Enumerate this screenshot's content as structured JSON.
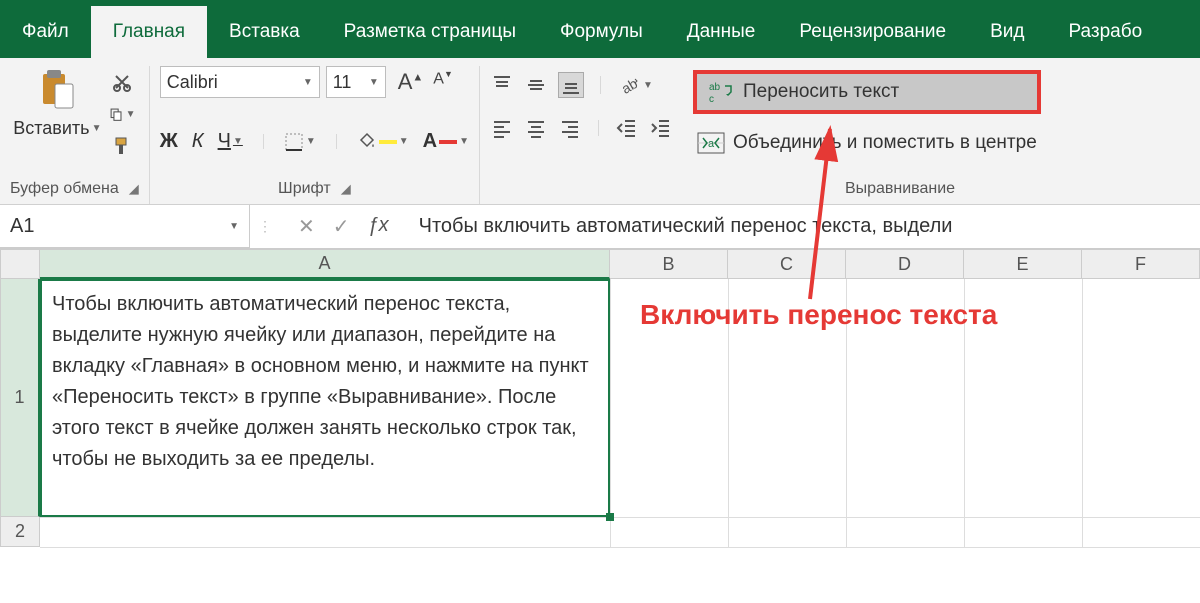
{
  "tabs": {
    "file": "Файл",
    "home": "Главная",
    "insert": "Вставка",
    "pagelayout": "Разметка страницы",
    "formulas": "Формулы",
    "data": "Данные",
    "review": "Рецензирование",
    "view": "Вид",
    "developer": "Разрабо"
  },
  "ribbon": {
    "clipboard": {
      "label": "Буфер обмена",
      "paste": "Вставить"
    },
    "font": {
      "label": "Шрифт",
      "name": "Calibri",
      "size": "11",
      "bold": "Ж",
      "italic": "К",
      "underline": "Ч"
    },
    "alignment": {
      "label": "Выравнивание",
      "wrap": "Переносить текст",
      "merge": "Объединить и поместить в центре"
    }
  },
  "namebox": "A1",
  "formula_bar": "Чтобы включить автоматический перенос текста, выдели",
  "columns": [
    "A",
    "B",
    "C",
    "D",
    "E",
    "F"
  ],
  "rows": [
    "1",
    "2"
  ],
  "cell_a1": "Чтобы включить автоматический перенос текста, выделите нужную ячейку или диапазон, перейдите на вкладку «Главная» в основном меню, и нажмите на пункт «Переносить текст» в группе «Выравнивание». После этого текст в ячейке должен занять несколько строк так, чтобы не выходить за ее пределы.",
  "annotation": "Включить перенос текста",
  "col_widths": {
    "A": 570,
    "other": 118
  }
}
